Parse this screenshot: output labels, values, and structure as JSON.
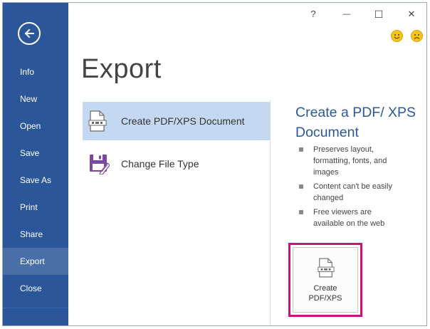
{
  "window": {
    "help_label": "?",
    "minimize_label": "—",
    "maximize_label": "☐",
    "close_label": "✕"
  },
  "feedback": {
    "happy_icon": "smiley-happy-icon",
    "sad_icon": "smiley-sad-icon"
  },
  "sidebar": {
    "back_icon": "back-arrow-icon",
    "items": [
      {
        "label": "Info"
      },
      {
        "label": "New"
      },
      {
        "label": "Open"
      },
      {
        "label": "Save"
      },
      {
        "label": "Save As"
      },
      {
        "label": "Print"
      },
      {
        "label": "Share"
      },
      {
        "label": "Export",
        "active": true
      },
      {
        "label": "Close"
      }
    ]
  },
  "page": {
    "title": "Export"
  },
  "options": [
    {
      "label": "Create PDF/XPS Document",
      "icon": "pdf-document-icon",
      "selected": true
    },
    {
      "label": "Change File Type",
      "icon": "change-file-type-icon",
      "selected": false
    }
  ],
  "panel": {
    "title": "Create a PDF/ XPS Document",
    "bullets": [
      "Preserves layout, formatting, fonts, and images",
      "Content can't be easily changed",
      "Free viewers are available on the web"
    ],
    "button_label": "Create PDF/XPS",
    "button_icon": "pdf-document-icon"
  },
  "colors": {
    "sidebar_bg": "#2b579a",
    "sidebar_active": "#4a6fa8",
    "selected_option": "#c5d8f1",
    "accent_text": "#2b579a",
    "highlight_border": "#c8137f"
  }
}
